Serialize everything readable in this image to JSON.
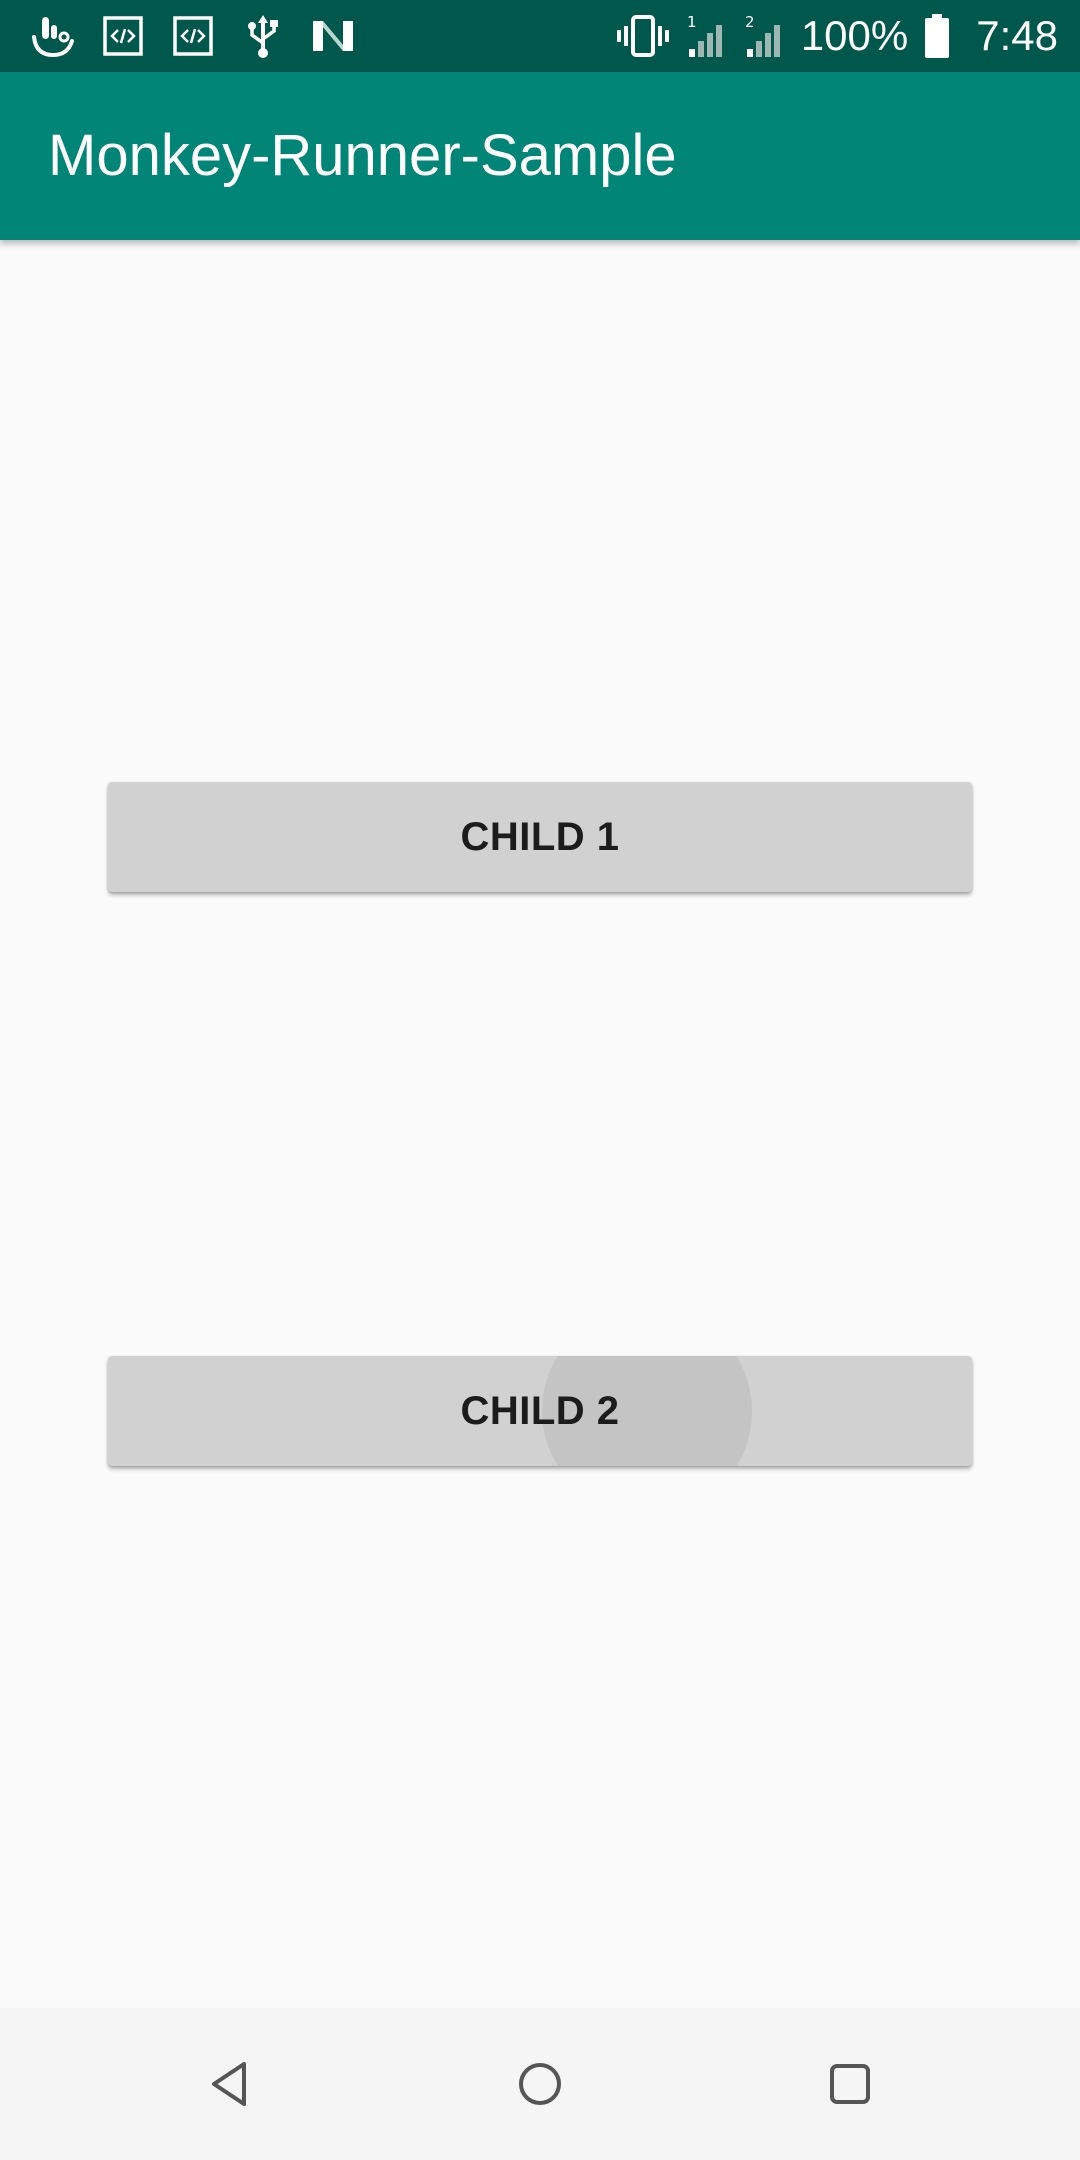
{
  "status_bar": {
    "background": "#00574b",
    "left_icons": [
      "touch-assistant-icon",
      "code-notification-icon",
      "code-notification-icon",
      "usb-icon",
      "n-logo-icon"
    ],
    "right_icons": [
      "vibrate-icon",
      "signal-sim1-icon",
      "signal-sim2-icon",
      "battery-full-icon"
    ],
    "battery_percent": "100%",
    "time": "7:48"
  },
  "app_bar": {
    "title": "Monkey-Runner-Sample",
    "background": "#008577"
  },
  "content": {
    "buttons": [
      {
        "label": "CHILD 1",
        "pressed": false
      },
      {
        "label": "CHILD 2",
        "pressed": true
      }
    ]
  },
  "nav_bar": {
    "buttons": [
      "back-icon",
      "home-icon",
      "recents-icon"
    ]
  }
}
